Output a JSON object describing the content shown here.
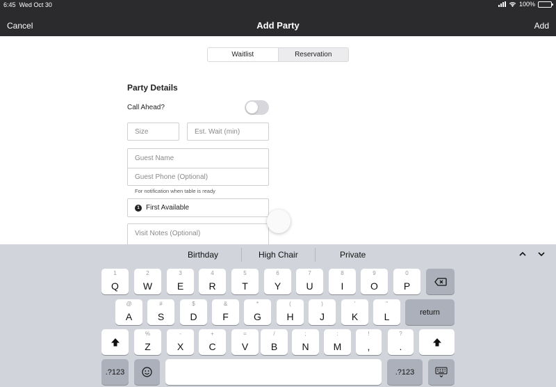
{
  "status": {
    "time": "6:45",
    "date": "Wed Oct 30",
    "battery": "100%"
  },
  "nav": {
    "cancel": "Cancel",
    "title": "Add Party",
    "add": "Add"
  },
  "segments": {
    "waitlist": "Waitlist",
    "reservation": "Reservation"
  },
  "form": {
    "section_title": "Party Details",
    "call_ahead_label": "Call Ahead?",
    "call_ahead_on": false,
    "size_placeholder": "Size",
    "wait_placeholder": "Est. Wait (min)",
    "name_placeholder": "Guest Name",
    "phone_placeholder": "Guest Phone (Optional)",
    "phone_hint": "For notification when table is ready",
    "table_badge": "1",
    "table_choice": "First Available",
    "notes_placeholder": "Visit Notes (Optional)"
  },
  "keyboard": {
    "suggestions": [
      "Birthday",
      "High Chair",
      "Private"
    ],
    "row1": [
      {
        "alt": "1",
        "key": "Q"
      },
      {
        "alt": "2",
        "key": "W"
      },
      {
        "alt": "3",
        "key": "E"
      },
      {
        "alt": "4",
        "key": "R"
      },
      {
        "alt": "5",
        "key": "T"
      },
      {
        "alt": "6",
        "key": "Y"
      },
      {
        "alt": "7",
        "key": "U"
      },
      {
        "alt": "8",
        "key": "I"
      },
      {
        "alt": "9",
        "key": "O"
      },
      {
        "alt": "0",
        "key": "P"
      }
    ],
    "row2": [
      {
        "alt": "@",
        "key": "A"
      },
      {
        "alt": "#",
        "key": "S"
      },
      {
        "alt": "$",
        "key": "D"
      },
      {
        "alt": "&",
        "key": "F"
      },
      {
        "alt": "*",
        "key": "G"
      },
      {
        "alt": "(",
        "key": "H"
      },
      {
        "alt": ")",
        "key": "J"
      },
      {
        "alt": "'",
        "key": "K"
      },
      {
        "alt": "\"",
        "key": "L"
      }
    ],
    "row3": [
      {
        "alt": "%",
        "key": "Z"
      },
      {
        "alt": "-",
        "key": "X"
      },
      {
        "alt": "+",
        "key": "C"
      },
      {
        "alt": "=",
        "key": "V"
      },
      {
        "alt": "/",
        "key": "B"
      },
      {
        "alt": ";",
        "key": "N"
      },
      {
        "alt": ":",
        "key": "M"
      },
      {
        "alt": "!",
        "key": ","
      },
      {
        "alt": "?",
        "key": "."
      }
    ],
    "return_label": "return",
    "numbers_label": ".?123"
  }
}
